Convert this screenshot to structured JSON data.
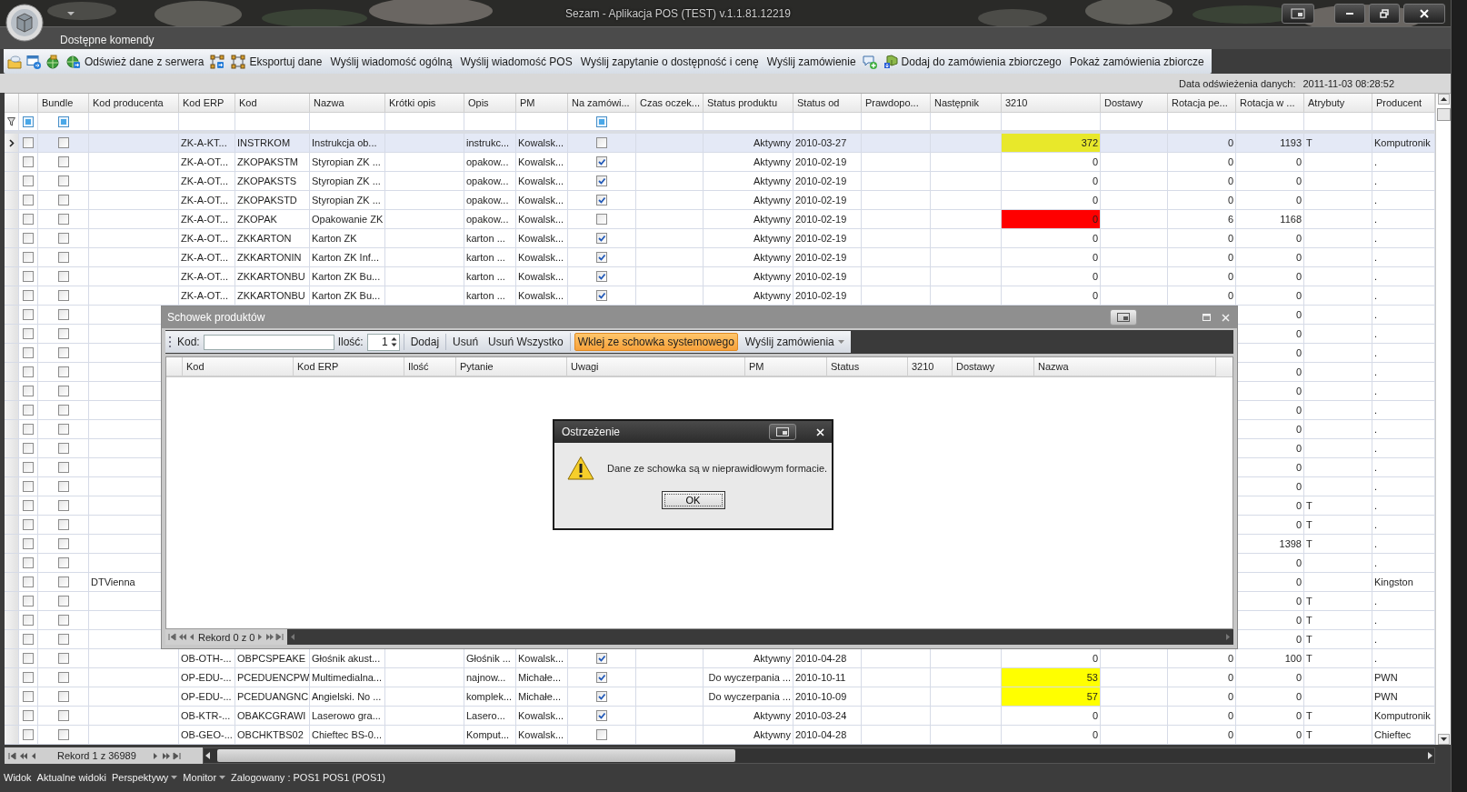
{
  "window": {
    "title": "Sezam - Aplikacja POS (TEST) v.1.1.81.12219"
  },
  "ribbon": {
    "tab": "Dostępne komendy",
    "toolbar": [
      {
        "kind": "icon"
      },
      {
        "kind": "icon"
      },
      {
        "kind": "icon"
      },
      {
        "kind": "icon_text",
        "label": "Odśwież dane z serwera"
      },
      {
        "kind": "icon"
      },
      {
        "kind": "icon_text",
        "label": "Eksportuj dane"
      },
      {
        "kind": "text",
        "label": "Wyślij wiadomość ogólną"
      },
      {
        "kind": "text",
        "label": "Wyślij wiadomość POS"
      },
      {
        "kind": "text",
        "label": "Wyślij zapytanie o dostępność i cenę"
      },
      {
        "kind": "text",
        "label": "Wyślij zamówienie"
      },
      {
        "kind": "icon"
      },
      {
        "kind": "icon_text",
        "label": "Dodaj do zamówienia zbiorczego"
      },
      {
        "kind": "text",
        "label": "Pokaż zamówienia zbiorcze"
      }
    ]
  },
  "refresh": {
    "label": "Data odświeżenia danych:",
    "value": "2011-11-03 08:28:52"
  },
  "table": {
    "columns": [
      "Bundle",
      "Kod producenta",
      "Kod ERP",
      "Kod",
      "Nazwa",
      "Krótki opis",
      "Opis",
      "PM",
      "Na zamówi...",
      "Czas oczek...",
      "Status produktu",
      "Status od",
      "Prawdopo...",
      "Następnik",
      "3210",
      "Dostawy",
      "Rotacja pe...",
      "Rotacja w ...",
      "Atrybuty",
      "Producent"
    ],
    "rows": [
      {
        "selected": true,
        "checked": false,
        "bundle": false,
        "kod_erp": "ZK-A-KT...",
        "kod": "INSTRKOM",
        "nazwa": "Instrukcja ob...",
        "opis": "instrukc...",
        "pm": "Kowalsk...",
        "na_zamowienie": false,
        "status_produktu": "Aktywny",
        "status_od": "2010-03-27",
        "qty_3210": {
          "value": "372",
          "color": "#e8e82a"
        },
        "rotacja_pe": "0",
        "rotacja_w": "1193",
        "atrybuty": "T",
        "producent": "Komputronik"
      },
      {
        "selected": false,
        "checked": false,
        "bundle": false,
        "kod_erp": "ZK-A-OT...",
        "kod": "ZKOPAKSTM",
        "nazwa": "Styropian ZK ...",
        "opis": "opakow...",
        "pm": "Kowalsk...",
        "na_zamowienie": true,
        "status_produktu": "Aktywny",
        "status_od": "2010-02-19",
        "qty_3210": {
          "value": "0"
        },
        "rotacja_pe": "0",
        "rotacja_w": "0",
        "producent": "."
      },
      {
        "selected": false,
        "checked": false,
        "bundle": false,
        "kod_erp": "ZK-A-OT...",
        "kod": "ZKOPAKSTS",
        "nazwa": "Styropian ZK ...",
        "opis": "opakow...",
        "pm": "Kowalsk...",
        "na_zamowienie": true,
        "status_produktu": "Aktywny",
        "status_od": "2010-02-19",
        "qty_3210": {
          "value": "0"
        },
        "rotacja_pe": "0",
        "rotacja_w": "0",
        "producent": "."
      },
      {
        "selected": false,
        "checked": false,
        "bundle": false,
        "kod_erp": "ZK-A-OT...",
        "kod": "ZKOPAKSTD",
        "nazwa": "Styropian ZK ...",
        "opis": "opakow...",
        "pm": "Kowalsk...",
        "na_zamowienie": true,
        "status_produktu": "Aktywny",
        "status_od": "2010-02-19",
        "qty_3210": {
          "value": "0"
        },
        "rotacja_pe": "0",
        "rotacja_w": "0",
        "producent": "."
      },
      {
        "selected": false,
        "checked": false,
        "bundle": false,
        "kod_erp": "ZK-A-OT...",
        "kod": "ZKOPAK",
        "nazwa": "Opakowanie ZK",
        "opis": "opakow...",
        "pm": "Kowalsk...",
        "na_zamowienie": false,
        "status_produktu": "Aktywny",
        "status_od": "2010-02-19",
        "qty_3210": {
          "value": "0",
          "color": "#ff0000"
        },
        "rotacja_pe": "6",
        "rotacja_w": "1168",
        "producent": "."
      },
      {
        "selected": false,
        "checked": false,
        "bundle": false,
        "kod_erp": "ZK-A-OT...",
        "kod": "ZKKARTON",
        "nazwa": "Karton ZK",
        "opis": "karton ...",
        "pm": "Kowalsk...",
        "na_zamowienie": true,
        "status_produktu": "Aktywny",
        "status_od": "2010-02-19",
        "qty_3210": {
          "value": "0"
        },
        "rotacja_pe": "0",
        "rotacja_w": "0",
        "producent": "."
      },
      {
        "selected": false,
        "checked": false,
        "bundle": false,
        "kod_erp": "ZK-A-OT...",
        "kod": "ZKKARTONIN",
        "nazwa": "Karton ZK Inf...",
        "opis": "karton ...",
        "pm": "Kowalsk...",
        "na_zamowienie": true,
        "status_produktu": "Aktywny",
        "status_od": "2010-02-19",
        "qty_3210": {
          "value": "0"
        },
        "rotacja_pe": "0",
        "rotacja_w": "0",
        "producent": "."
      },
      {
        "selected": false,
        "checked": false,
        "bundle": false,
        "kod_erp": "ZK-A-OT...",
        "kod": "ZKKARTONBU",
        "nazwa": "Karton ZK Bu...",
        "opis": "karton ...",
        "pm": "Kowalsk...",
        "na_zamowienie": true,
        "status_produktu": "Aktywny",
        "status_od": "2010-02-19",
        "qty_3210": {
          "value": "0"
        },
        "rotacja_pe": "0",
        "rotacja_w": "0",
        "producent": "."
      },
      {
        "selected": false,
        "checked": false,
        "bundle": false,
        "kod_erp": "ZK-A-OT...",
        "kod": "ZKKARTONBU",
        "nazwa": "Karton ZK Bu...",
        "opis": "karton ...",
        "pm": "Kowalsk...",
        "na_zamowienie": true,
        "status_produktu": "Aktywny",
        "status_od": "2010-02-19",
        "qty_3210": {
          "value": "0"
        },
        "rotacja_pe": "0",
        "rotacja_w": "0",
        "producent": "."
      },
      {
        "selected": false,
        "checked": false,
        "bundle": false,
        "rotacja_w": "0",
        "producent": "."
      },
      {
        "selected": false,
        "checked": false,
        "bundle": false,
        "rotacja_w": "0",
        "producent": "."
      },
      {
        "selected": false,
        "checked": false,
        "bundle": false,
        "rotacja_w": "0",
        "producent": "."
      },
      {
        "selected": false,
        "checked": false,
        "bundle": false,
        "rotacja_w": "0",
        "producent": "."
      },
      {
        "selected": false,
        "checked": false,
        "bundle": false,
        "rotacja_w": "0",
        "producent": "."
      },
      {
        "selected": false,
        "checked": false,
        "bundle": false,
        "rotacja_w": "0",
        "producent": "."
      },
      {
        "selected": false,
        "checked": false,
        "bundle": false,
        "rotacja_w": "0",
        "producent": "."
      },
      {
        "selected": false,
        "checked": false,
        "bundle": false,
        "rotacja_w": "0",
        "producent": "."
      },
      {
        "selected": false,
        "checked": false,
        "bundle": false,
        "rotacja_w": "0",
        "producent": "."
      },
      {
        "selected": false,
        "checked": false,
        "bundle": false,
        "rotacja_w": "0",
        "producent": "."
      },
      {
        "selected": false,
        "checked": false,
        "bundle": false,
        "rotacja_w": "0",
        "atrybuty": "T",
        "producent": "."
      },
      {
        "selected": false,
        "checked": false,
        "bundle": false,
        "rotacja_w": "0",
        "atrybuty": "T",
        "producent": "."
      },
      {
        "selected": false,
        "checked": false,
        "bundle": false,
        "rotacja_w": "1398",
        "atrybuty": "T",
        "producent": "."
      },
      {
        "selected": false,
        "checked": false,
        "bundle": false,
        "rotacja_w": "0",
        "producent": "."
      },
      {
        "selected": false,
        "checked": false,
        "bundle": false,
        "kod_producenta": "DTVienna",
        "rotacja_w": "0",
        "producent": "Kingston"
      },
      {
        "selected": false,
        "checked": false,
        "bundle": false,
        "rotacja_w": "0",
        "atrybuty": "T",
        "producent": "."
      },
      {
        "selected": false,
        "checked": false,
        "bundle": false,
        "rotacja_w": "0",
        "atrybuty": "T",
        "producent": "."
      },
      {
        "selected": false,
        "checked": false,
        "bundle": false,
        "rotacja_w": "0",
        "atrybuty": "T",
        "producent": "."
      },
      {
        "selected": false,
        "checked": false,
        "bundle": false,
        "kod_erp": "OB-OTH-...",
        "kod": "OBPCSPEAKE",
        "nazwa": "Głośnik akust...",
        "opis": "Głośnik ...",
        "pm": "Kowalsk...",
        "na_zamowienie": true,
        "status_produktu": "Aktywny",
        "status_od": "2010-04-28",
        "qty_3210": {
          "value": "0"
        },
        "rotacja_pe": "0",
        "rotacja_w": "100",
        "atrybuty": "T",
        "producent": "."
      },
      {
        "selected": false,
        "checked": false,
        "bundle": false,
        "kod_erp": "OP-EDU-...",
        "kod": "PCEDUENCPW",
        "nazwa": "Multimedialna...",
        "opis": "najnow...",
        "pm": "Michałe...",
        "na_zamowienie": true,
        "status_produktu": "Do wyczerpania ...",
        "status_od": "2010-10-11",
        "qty_3210": {
          "value": "53",
          "color": "#ffff00"
        },
        "rotacja_pe": "0",
        "rotacja_w": "0",
        "producent": "PWN"
      },
      {
        "selected": false,
        "checked": false,
        "bundle": false,
        "kod_erp": "OP-EDU-...",
        "kod": "PCEDUANGNC",
        "nazwa": "Angielski. No ...",
        "opis": "komplek...",
        "pm": "Michałe...",
        "na_zamowienie": true,
        "status_produktu": "Do wyczerpania ...",
        "status_od": "2010-10-09",
        "qty_3210": {
          "value": "57",
          "color": "#ffff00"
        },
        "rotacja_pe": "0",
        "rotacja_w": "0",
        "producent": "PWN"
      },
      {
        "selected": false,
        "checked": false,
        "bundle": false,
        "kod_erp": "OB-KTR-...",
        "kod": "OBAKCGRAWI",
        "nazwa": "Laserowo gra...",
        "opis": "Lasero...",
        "pm": "Kowalsk...",
        "na_zamowienie": true,
        "status_produktu": "Aktywny",
        "status_od": "2010-03-24",
        "qty_3210": {
          "value": "0"
        },
        "rotacja_pe": "0",
        "rotacja_w": "0",
        "atrybuty": "T",
        "producent": "Komputronik"
      },
      {
        "selected": false,
        "checked": false,
        "bundle": false,
        "kod_erp": "OB-GEO-...",
        "kod": "OBCHKTBS02",
        "nazwa": "Chieftec BS-0...",
        "opis": "Komput...",
        "pm": "Kowalsk...",
        "na_zamowienie": false,
        "status_produktu": "Aktywny",
        "status_od": "2010-04-28",
        "qty_3210": {
          "value": "0"
        },
        "rotacja_pe": "0",
        "rotacja_w": "0",
        "atrybuty": "T",
        "producent": "Chieftec"
      }
    ]
  },
  "pager": {
    "record": "Rekord 1 z 36989"
  },
  "status_bar": [
    {
      "kind": "menu",
      "label": "Widok"
    },
    {
      "kind": "menu",
      "label": "Aktualne widoki"
    },
    {
      "kind": "dropdown",
      "label": "Perspektywy"
    },
    {
      "kind": "dropdown",
      "label": "Monitor"
    },
    {
      "kind": "text",
      "label": "Zalogowany : POS1 POS1 (POS1)"
    }
  ],
  "clipboard_window": {
    "title": "Schowek produktów",
    "code_label": "Kod:",
    "quantity_label": "Ilość:",
    "quantity": "1",
    "button_groups": [
      [
        {
          "kind": "button",
          "label": "Dodaj",
          "highlighted": false
        }
      ],
      [
        {
          "kind": "button",
          "label": "Usuń",
          "highlighted": false
        },
        {
          "kind": "button",
          "label": "Usuń Wszystko",
          "highlighted": false
        }
      ],
      [
        {
          "kind": "button",
          "label": "Wklej ze schowka systemowego",
          "highlighted": true
        },
        {
          "kind": "dropdown",
          "label": "Wyślij zamówienia",
          "highlighted": false
        }
      ]
    ],
    "columns": [
      "Kod",
      "Kod ERP",
      "Ilość",
      "Pytanie",
      "Uwagi",
      "PM",
      "Status",
      "3210",
      "Dostawy",
      "Nazwa"
    ],
    "record": "Rekord 0 z 0"
  },
  "warning_dialog": {
    "title": "Ostrzeżenie",
    "message": "Dane ze schowka są w nieprawidłowym formacie.",
    "ok": "OK"
  }
}
